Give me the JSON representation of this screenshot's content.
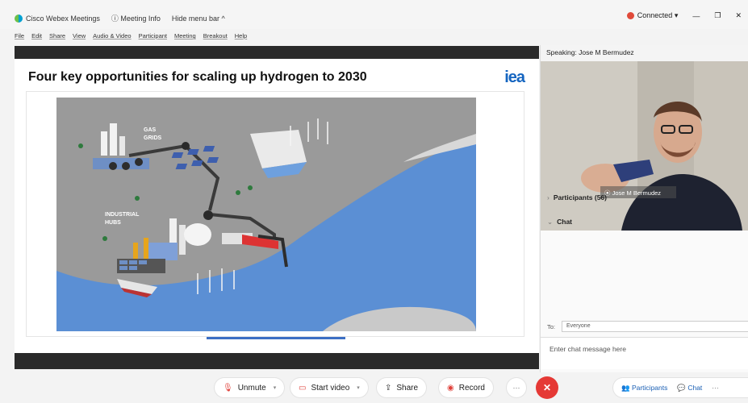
{
  "titlebar": {
    "app_name": "Cisco Webex Meetings",
    "meeting_info": "Meeting Info",
    "hide_menu": "Hide menu bar ^",
    "connection_status": "Connected",
    "status_caret": "▾",
    "minimize": "—",
    "restore": "❐",
    "close": "✕"
  },
  "menu": [
    "File",
    "Edit",
    "Share",
    "View",
    "Audio & Video",
    "Participant",
    "Meeting",
    "Breakout",
    "Help"
  ],
  "slide": {
    "title": "Four key opportunities for scaling up hydrogen to 2030",
    "logo": "iea",
    "labels": {
      "gas_grids_1": "GAS",
      "gas_grids_2": "GRIDS",
      "industrial_1": "INDUSTRIAL",
      "industrial_2": "HUBS"
    }
  },
  "side_panel": {
    "speaking_label": "Speaking: Jose M Bermudez",
    "video_name": "Jose M Bermudez",
    "participants_label": "Participants (56)",
    "chat_label": "Chat",
    "to_label": "To:",
    "to_value": "Everyone",
    "chat_placeholder": "Enter chat message here"
  },
  "controls": {
    "unmute": "Unmute",
    "start_video": "Start video",
    "share": "Share",
    "record": "Record",
    "more": "···",
    "end": "✕",
    "participants": "Participants",
    "chat": "Chat",
    "overflow": "···"
  },
  "colors": {
    "accent": "#1565c0",
    "end_call": "#e53935",
    "water": "#5b8fd4",
    "land": "#9a9a9a"
  }
}
